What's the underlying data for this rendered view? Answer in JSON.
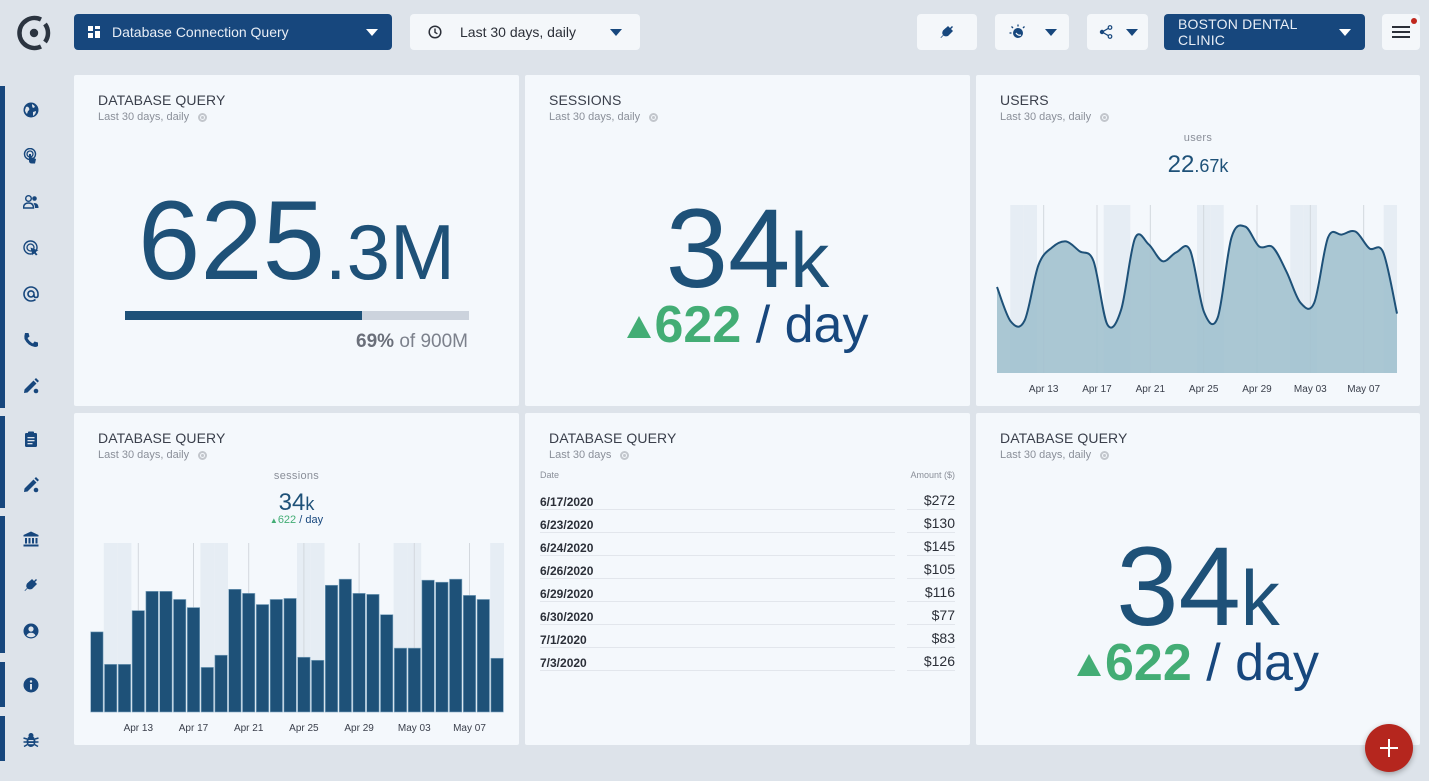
{
  "topbar": {
    "dashboard_select": {
      "label": "Database Connection Query",
      "icon": "dashboard-icon"
    },
    "range_select": {
      "label": "Last 30 days, daily",
      "icon": "clock-icon"
    },
    "plugin_button": {
      "icon": "plug-icon"
    },
    "theme_button": {
      "icon": "theme-toggle-icon"
    },
    "share_button": {
      "icon": "share-icon"
    },
    "org_select": {
      "label": "BOSTON DENTAL CLINIC"
    },
    "menu_button": {
      "icon": "hamburger-menu-icon",
      "has_notification": true
    }
  },
  "sidebar": {
    "items": [
      {
        "name": "globe",
        "icon": "globe-icon"
      },
      {
        "name": "touch",
        "icon": "touch-icon"
      },
      {
        "name": "users",
        "icon": "users-icon"
      },
      {
        "name": "clicks",
        "icon": "click-target-icon"
      },
      {
        "name": "email",
        "icon": "at-sign-icon"
      },
      {
        "name": "phone",
        "icon": "phone-icon"
      },
      {
        "name": "edit",
        "icon": "pencil-icon"
      },
      {
        "name": "reports",
        "icon": "clipboard-icon"
      },
      {
        "name": "edit-2",
        "icon": "pencil-icon"
      },
      {
        "name": "bank",
        "icon": "bank-icon"
      },
      {
        "name": "plugins",
        "icon": "plug-icon"
      },
      {
        "name": "account",
        "icon": "account-circle-icon"
      },
      {
        "name": "info",
        "icon": "info-icon"
      },
      {
        "name": "debug",
        "icon": "bug-icon"
      }
    ]
  },
  "cards": {
    "db_query_total": {
      "title": "DATABASE QUERY",
      "subtitle": "Last 30 days, daily",
      "value_int": "625",
      "value_dec": ".3M",
      "progress_fraction": 0.69,
      "progress_pct_label": "69%",
      "progress_of_label": "of 900M"
    },
    "sessions": {
      "title": "SESSIONS",
      "subtitle": "Last 30 days, daily",
      "value": "34",
      "unit": "k",
      "delta": "622",
      "delta_suffix": "/ day",
      "delta_direction": "up"
    },
    "users": {
      "title": "USERS",
      "subtitle": "Last 30 days, daily",
      "metric_label": "users",
      "value_int": "22",
      "value_dec": ".67k"
    },
    "db_query_sessions": {
      "title": "DATABASE QUERY",
      "subtitle": "Last 30 days, daily",
      "metric_label": "sessions",
      "value": "34",
      "unit": "k",
      "delta": "622",
      "delta_suffix": "/ day"
    },
    "db_query_table": {
      "title": "DATABASE QUERY",
      "subtitle": "Last 30 days",
      "columns": [
        "Date",
        "Amount ($)"
      ],
      "rows": [
        {
          "date": "6/17/2020",
          "amount": "$272"
        },
        {
          "date": "6/23/2020",
          "amount": "$130"
        },
        {
          "date": "6/24/2020",
          "amount": "$145"
        },
        {
          "date": "6/26/2020",
          "amount": "$105"
        },
        {
          "date": "6/29/2020",
          "amount": "$116"
        },
        {
          "date": "6/30/2020",
          "amount": "$77"
        },
        {
          "date": "7/1/2020",
          "amount": "$83"
        },
        {
          "date": "7/3/2020",
          "amount": "$126"
        }
      ]
    },
    "db_query_kpi": {
      "title": "DATABASE QUERY",
      "subtitle": "Last 30 days, daily",
      "value": "34",
      "unit": "k",
      "delta": "622",
      "delta_suffix": "/ day",
      "delta_direction": "up"
    }
  },
  "fab": {
    "icon": "plus-icon",
    "label": "Add widget"
  },
  "colors": {
    "brand": "#17477d",
    "value": "#1e5178",
    "positive": "#43ad75",
    "fab": "#b5261e",
    "area_fill": "#a3c2cf",
    "weekend_shade": "#e6edf4"
  },
  "chart_data": [
    {
      "id": "users",
      "type": "area",
      "title": "users",
      "x_start": "2020-04-10",
      "x_tick_labels": [
        "Apr 13",
        "Apr 17",
        "Apr 21",
        "Apr 25",
        "Apr 29",
        "May 03",
        "May 07"
      ],
      "x_tick_indices": [
        3,
        7,
        11,
        15,
        19,
        23,
        27
      ],
      "weekend_indices": [
        1,
        2,
        8,
        9,
        15,
        16,
        22,
        23,
        29
      ],
      "values": [
        640,
        383,
        390,
        802,
        935,
        979,
        905,
        832,
        361,
        471,
        1001,
        957,
        832,
        898,
        913,
        456,
        412,
        1008,
        1089,
        942,
        935,
        751,
        523,
        523,
        1008,
        1030,
        1052,
        927,
        898,
        442
      ],
      "ylim": [
        0,
        1250
      ],
      "grid": "vertical-weekly",
      "xlabel": "",
      "ylabel": ""
    },
    {
      "id": "sessions",
      "type": "bar",
      "title": "sessions",
      "x_start": "2020-04-10",
      "x_tick_labels": [
        "Apr 13",
        "Apr 17",
        "Apr 21",
        "Apr 25",
        "Apr 29",
        "May 03",
        "May 07"
      ],
      "x_tick_indices": [
        3,
        7,
        11,
        15,
        19,
        23,
        27
      ],
      "weekend_indices": [
        1,
        2,
        8,
        9,
        15,
        16,
        22,
        23,
        29
      ],
      "values": [
        948,
        564,
        564,
        1200,
        1428,
        1428,
        1332,
        1236,
        528,
        672,
        1452,
        1404,
        1272,
        1332,
        1344,
        648,
        612,
        1500,
        1572,
        1404,
        1392,
        1152,
        756,
        756,
        1560,
        1536,
        1572,
        1380,
        1332,
        636
      ],
      "ylim": [
        0,
        2000
      ],
      "grid": "vertical-weekly",
      "xlabel": "",
      "ylabel": ""
    }
  ]
}
